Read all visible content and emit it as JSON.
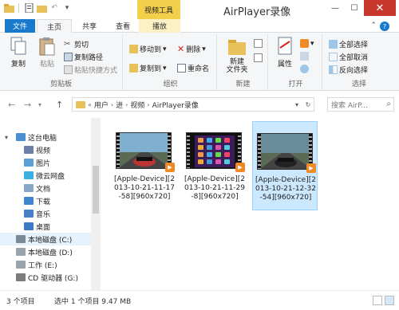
{
  "window": {
    "context_tab_title": "视频工具",
    "title": "AirPlayer录像"
  },
  "tabs": {
    "file": "文件",
    "home": "主页",
    "share": "共享",
    "view": "查看",
    "play": "播放"
  },
  "ribbon": {
    "clipboard": {
      "copy": "复制",
      "paste": "粘贴",
      "cut": "剪切",
      "copy_path": "复制路径",
      "paste_shortcut": "粘贴快捷方式",
      "label": "剪贴板"
    },
    "organize": {
      "move_to": "移动到",
      "copy_to": "复制到",
      "delete": "删除",
      "rename": "重命名",
      "label": "组织"
    },
    "new": {
      "new_folder": "新建\n文件夹",
      "label": "新建"
    },
    "open": {
      "properties": "属性",
      "label": "打开"
    },
    "select": {
      "select_all": "全部选择",
      "select_none": "全部取消",
      "invert": "反向选择",
      "label": "选择"
    }
  },
  "address": {
    "crumbs": [
      "用户",
      "进",
      "视频",
      "AirPlayer录像"
    ],
    "search_placeholder": "搜索 AirP..."
  },
  "sidebar": {
    "items": [
      {
        "label": "这台电脑",
        "color": "#4a8fd4"
      },
      {
        "label": "视频",
        "color": "#6b7fa8"
      },
      {
        "label": "图片",
        "color": "#5aa0d8"
      },
      {
        "label": "微云网盘",
        "color": "#3ab0e2"
      },
      {
        "label": "文档",
        "color": "#8aa6c8"
      },
      {
        "label": "下载",
        "color": "#3f86cf"
      },
      {
        "label": "音乐",
        "color": "#4a7fc8"
      },
      {
        "label": "桌面",
        "color": "#3a7bc4"
      },
      {
        "label": "本地磁盘 (C:)",
        "color": "#7a8a99"
      },
      {
        "label": "本地磁盘 (D:)",
        "color": "#9aa4ad"
      },
      {
        "label": "工作 (E:)",
        "color": "#9aa4ad"
      },
      {
        "label": "CD 驱动器 (G:)",
        "color": "#7c7c7c"
      }
    ],
    "selected_index": 8
  },
  "files": [
    {
      "name": "[Apple-Device][2013-10-21-11-17-58][960x720]",
      "selected": false,
      "scene": "car"
    },
    {
      "name": "[Apple-Device][2013-10-21-11-29-8][960x720]",
      "selected": false,
      "scene": "ios"
    },
    {
      "name": "[Apple-Device][2013-10-21-12-32-54][960x720]",
      "selected": true,
      "scene": "car2"
    }
  ],
  "status": {
    "count": "3 个项目",
    "selection": "选中 1 个项目  9.47 MB"
  },
  "colors": {
    "accent": "#1979ca",
    "context_tab": "#f2d04b",
    "selection": "#cce8ff"
  }
}
